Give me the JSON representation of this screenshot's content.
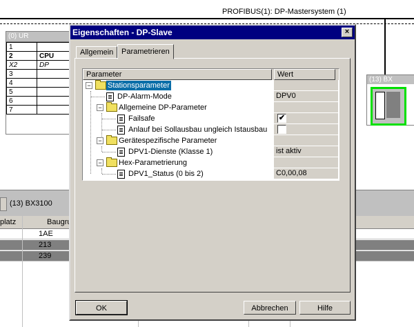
{
  "network": {
    "bus_label": "PROFIBUS(1): DP-Mastersystem (1)"
  },
  "rack": {
    "title": "(0) UR",
    "rows": [
      {
        "slot": "1",
        "module": ""
      },
      {
        "slot": "2",
        "module": "CPU"
      },
      {
        "slot": "X2",
        "module": "DP"
      },
      {
        "slot": "3",
        "module": ""
      },
      {
        "slot": "4",
        "module": ""
      },
      {
        "slot": "5",
        "module": ""
      },
      {
        "slot": "6",
        "module": ""
      },
      {
        "slot": "7",
        "module": ""
      }
    ]
  },
  "slave_node": {
    "title": "(13) BX"
  },
  "lower_view": {
    "station": "(13)   BX3100",
    "columns": [
      "platz",
      "Baugru"
    ],
    "rows": [
      "1AE",
      "213",
      "239"
    ]
  },
  "dialog": {
    "title": "Eigenschaften - DP-Slave",
    "close_glyph": "×",
    "tabs": [
      "Allgemein",
      "Parametrieren"
    ],
    "active_tab": "Parametrieren",
    "columns": {
      "param": "Parameter",
      "value": "Wert"
    },
    "tree": [
      {
        "label": "Stationsparameter",
        "value": "",
        "level": 0,
        "type": "folder",
        "expander": "−"
      },
      {
        "label": "DP-Alarm-Mode",
        "value": "DPV0",
        "level": 1,
        "type": "param"
      },
      {
        "label": "Allgemeine DP-Parameter",
        "value": "",
        "level": 1,
        "type": "folder",
        "expander": "−"
      },
      {
        "label": "Failsafe",
        "value": "✔",
        "level": 2,
        "type": "param",
        "checkbox": true
      },
      {
        "label": "Anlauf bei Sollausbau ungleich Istausbau",
        "value": "",
        "level": 2,
        "type": "param",
        "checkbox": true
      },
      {
        "label": "Gerätespezifische Parameter",
        "value": "",
        "level": 1,
        "type": "folder",
        "expander": "−"
      },
      {
        "label": "DPV1-Dienste (Klasse 1)",
        "value": "ist aktiv",
        "level": 2,
        "type": "param"
      },
      {
        "label": "Hex-Parametrierung",
        "value": "",
        "level": 1,
        "type": "folder",
        "expander": "−"
      },
      {
        "label": "DPV1_Status (0 bis 2)",
        "value": "C0,00,08",
        "level": 2,
        "type": "param"
      }
    ],
    "buttons": {
      "ok": "OK",
      "cancel": "Abbrechen",
      "help": "Hilfe"
    }
  }
}
